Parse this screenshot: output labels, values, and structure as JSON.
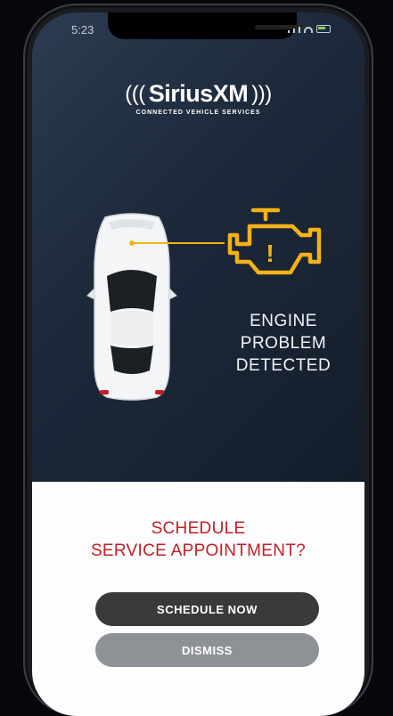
{
  "status_bar": {
    "time": "5:23"
  },
  "logo": {
    "brand": "SiriusXM",
    "tagline": "CONNECTED VEHICLE SERVICES"
  },
  "alert": {
    "lines": [
      "ENGINE",
      "PROBLEM",
      "DETECTED"
    ],
    "icon": "check-engine-icon",
    "icon_color": "#f3b216"
  },
  "prompt": {
    "lines": [
      "SCHEDULE",
      "SERVICE APPOINTMENT?"
    ],
    "color": "#c41e26"
  },
  "buttons": {
    "schedule_label": "SCHEDULE NOW",
    "dismiss_label": "DISMISS"
  }
}
